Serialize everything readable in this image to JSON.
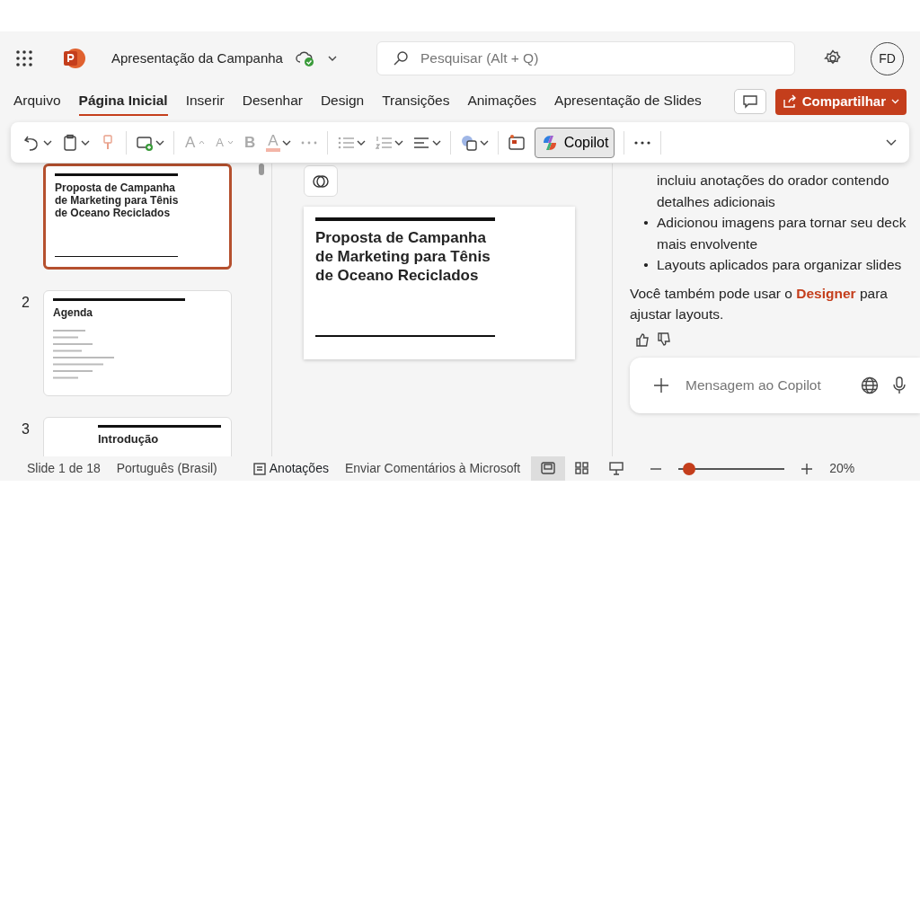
{
  "title_bar": {
    "document_title": "Apresentação da Campanha",
    "search_placeholder": "Pesquisar (Alt + Q)",
    "avatar": "FD"
  },
  "tabs": [
    {
      "label": "Arquivo",
      "selected": false
    },
    {
      "label": "Página Inicial",
      "selected": true
    },
    {
      "label": "Inserir",
      "selected": false
    },
    {
      "label": "Desenhar",
      "selected": false
    },
    {
      "label": "Design",
      "selected": false
    },
    {
      "label": "Transições",
      "selected": false
    },
    {
      "label": "Animações",
      "selected": false
    },
    {
      "label": "Apresentação de Slides",
      "selected": false
    }
  ],
  "share_button": "Compartilhar",
  "toolbar": {
    "format_glyphs": [
      {
        "kind": "grow",
        "glyph": "A"
      },
      {
        "kind": "shrink",
        "glyph": "A"
      },
      {
        "kind": "bold",
        "glyph": "B"
      },
      {
        "kind": "color",
        "glyph": "A"
      }
    ],
    "copilot_button": {
      "label": "Copilot",
      "selected": true
    }
  },
  "slides": [
    {
      "kind": "title",
      "title": "Proposta de Campanha de Marketing para Tênis de Oceano Reciclados",
      "selected": true
    },
    {
      "kind": "agenda",
      "number": "2",
      "title": "Agenda",
      "selected": false
    },
    {
      "kind": "section",
      "number": "3",
      "title": "Introdução",
      "selected": false
    }
  ],
  "editor": {
    "slide_title": "Proposta de Campanha de Marketing para Tênis de Oceano Reciclados"
  },
  "copilot": {
    "items": [
      {
        "kind": "continuation",
        "text": "incluiu anotações do orador contendo detalhes adicionais"
      },
      {
        "kind": "bullet",
        "marker": "•",
        "text": "Adicionou imagens para tornar seu deck mais envolvente"
      },
      {
        "kind": "bullet",
        "marker": "•",
        "text": "Layouts aplicados para organizar slides"
      }
    ],
    "note_before": "Você também pode usar o",
    "note_link": "Designer",
    "note_after": "para ajustar layouts.",
    "input_placeholder": "Mensagem ao Copilot"
  },
  "status_bar": {
    "slide_count": "Slide 1 de 18",
    "language": "Português (Brasil)",
    "notes": "Anotações",
    "feedback": "Enviar Comentários à Microsoft",
    "views": [
      {
        "kind": "normal",
        "selected": true
      },
      {
        "kind": "sorter",
        "selected": false
      },
      {
        "kind": "presenter",
        "selected": false
      }
    ],
    "zoom": {
      "level": 0.05
    },
    "zoom_reading": "20%"
  }
}
